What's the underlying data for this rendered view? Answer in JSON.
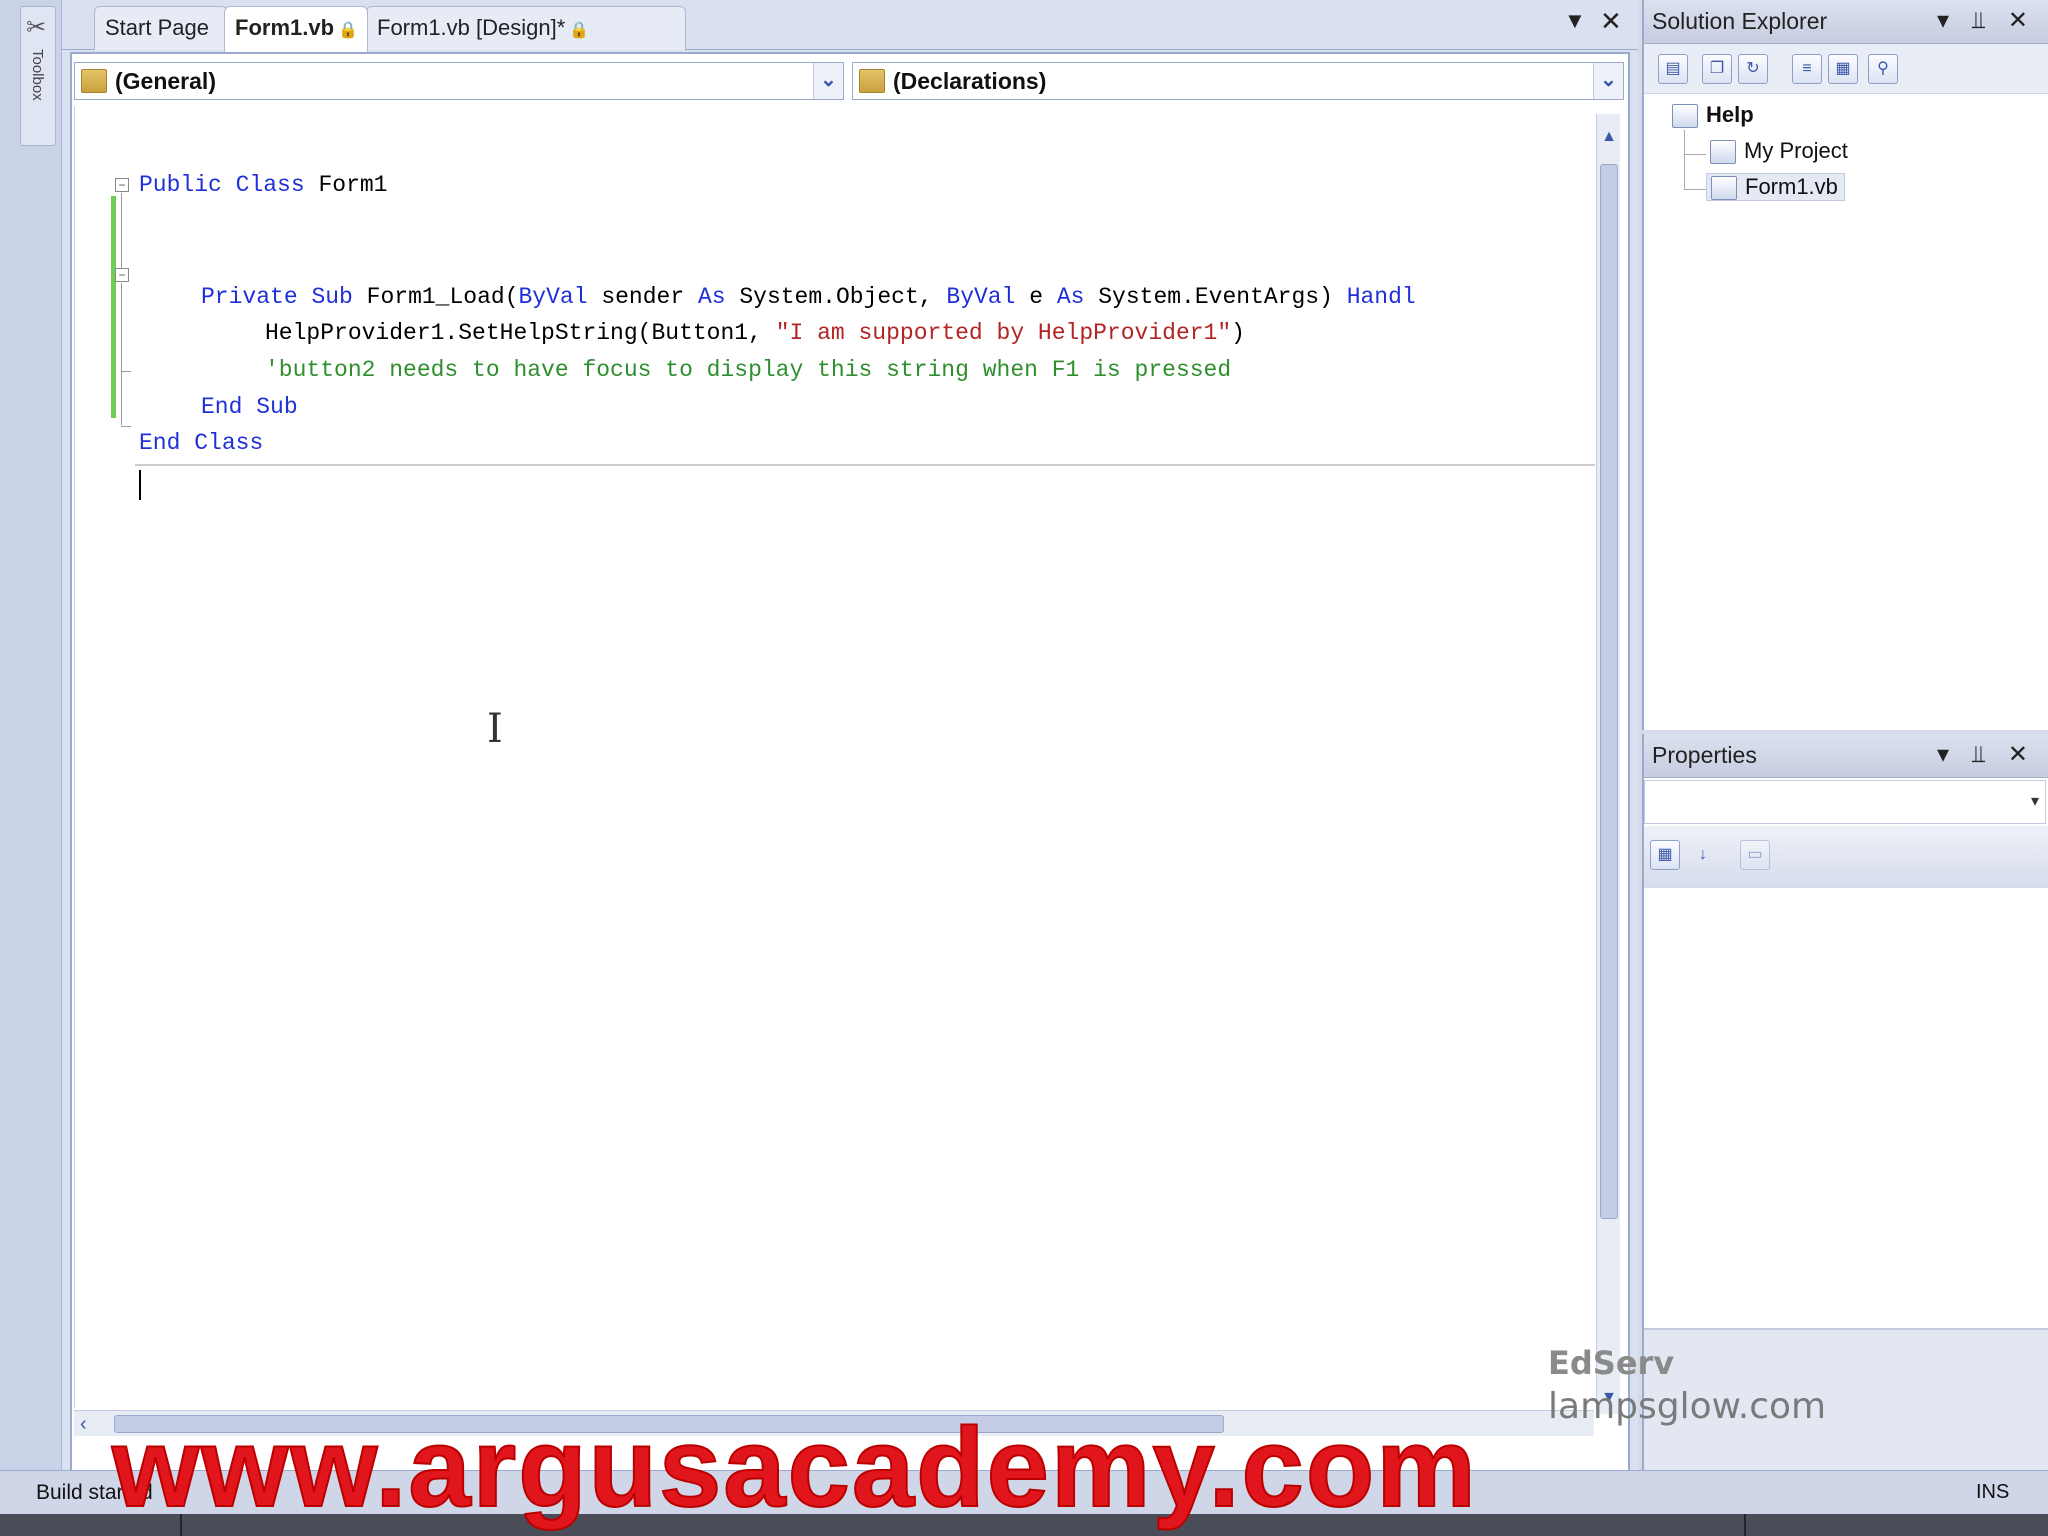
{
  "toolbox": {
    "label": "Toolbox"
  },
  "tabs": [
    {
      "label": "Start Page"
    },
    {
      "label": "Form1.vb"
    },
    {
      "label": "Form1.vb [Design]*"
    }
  ],
  "tab_controls": {
    "dropdown": "▼",
    "close": "✕"
  },
  "combos": {
    "class_name": "(General)",
    "method_name": "(Declarations)"
  },
  "code": {
    "line1": {
      "kw1": "Public",
      "kw2": "Class",
      "text": "Form1"
    },
    "line2": {
      "kw1": "Private",
      "kw2": "Sub",
      "t1": "Form1_Load(",
      "kw3": "ByVal",
      "t2": " sender ",
      "kw4": "As",
      "t3": " System.Object, ",
      "kw5": "ByVal",
      "t4": " e ",
      "kw6": "As",
      "t5": " System.EventArgs) ",
      "kw7": "Handl"
    },
    "line3": {
      "text": "HelpProvider1.SetHelpString(Button1, ",
      "str": "\"I am supported by HelpProvider1\"",
      "end": ")"
    },
    "line4": {
      "comment": "'button2 needs to have focus to display this string when F1 is pressed"
    },
    "line5": {
      "kw1": "End",
      "kw2": "Sub"
    },
    "line6": {
      "kw1": "End",
      "kw2": "Class"
    }
  },
  "solution_explorer": {
    "title": "Solution Explorer",
    "controls": "▾ ⫫ ✕",
    "tree": {
      "project": "Help",
      "items": [
        "My Project",
        "Form1.vb"
      ]
    }
  },
  "properties": {
    "title": "Properties",
    "controls": "▾ ⫫ ✕"
  },
  "watermark": {
    "line1": "EdServ",
    "line2": "lampsglow.com"
  },
  "status": {
    "text": "Build started",
    "ins": "INS"
  },
  "banner": {
    "text": "www.argusacademy.com"
  },
  "colors": {
    "keyword": "#2030d8",
    "string": "#b32424",
    "comment": "#2f8f2f",
    "banner": "#e0161c"
  }
}
